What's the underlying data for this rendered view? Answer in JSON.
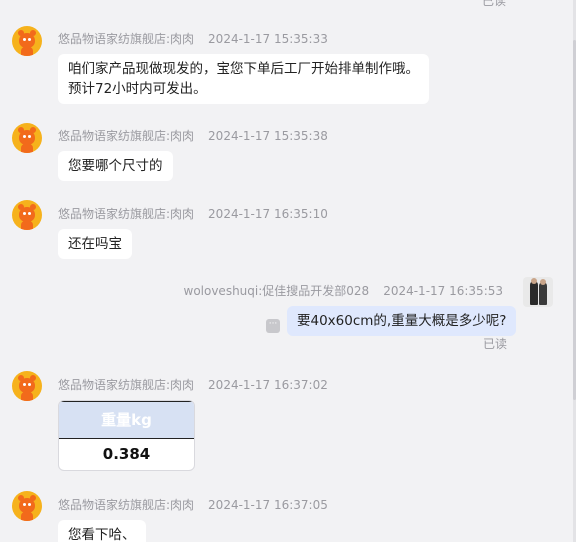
{
  "top_read": "已读",
  "messages": [
    {
      "sender": "悠品物语家纺旗舰店:肉肉",
      "time": "2024-1-17 15:35:33",
      "lines": [
        "咱们家产品现做现发的，宝您下单后工厂开始排单制作哦。",
        "预计72小时内可发出。"
      ]
    },
    {
      "sender": "悠品物语家纺旗舰店:肉肉",
      "time": "2024-1-17 15:35:38",
      "lines": [
        "您要哪个尺寸的"
      ]
    },
    {
      "sender": "悠品物语家纺旗舰店:肉肉",
      "time": "2024-1-17 16:35:10",
      "lines": [
        "还在吗宝"
      ]
    },
    {
      "sender": "woloveshuqi:促佳搜品开发部028",
      "time": "2024-1-17 16:35:53",
      "lines": [
        "要40x60cm的,重量大概是多少呢?"
      ],
      "status": "已读"
    },
    {
      "sender": "悠品物语家纺旗舰店:肉肉",
      "time": "2024-1-17 16:37:02",
      "card": {
        "header": "重量kg",
        "value": "0.384"
      }
    },
    {
      "sender": "悠品物语家纺旗舰店:肉肉",
      "time": "2024-1-17 16:37:05",
      "lines": [
        "您看下哈、"
      ]
    }
  ],
  "icons": {
    "shop_avatar": "mascot-avatar-icon",
    "user_avatar": "user-avatar-icon",
    "more": "more-options-icon"
  }
}
